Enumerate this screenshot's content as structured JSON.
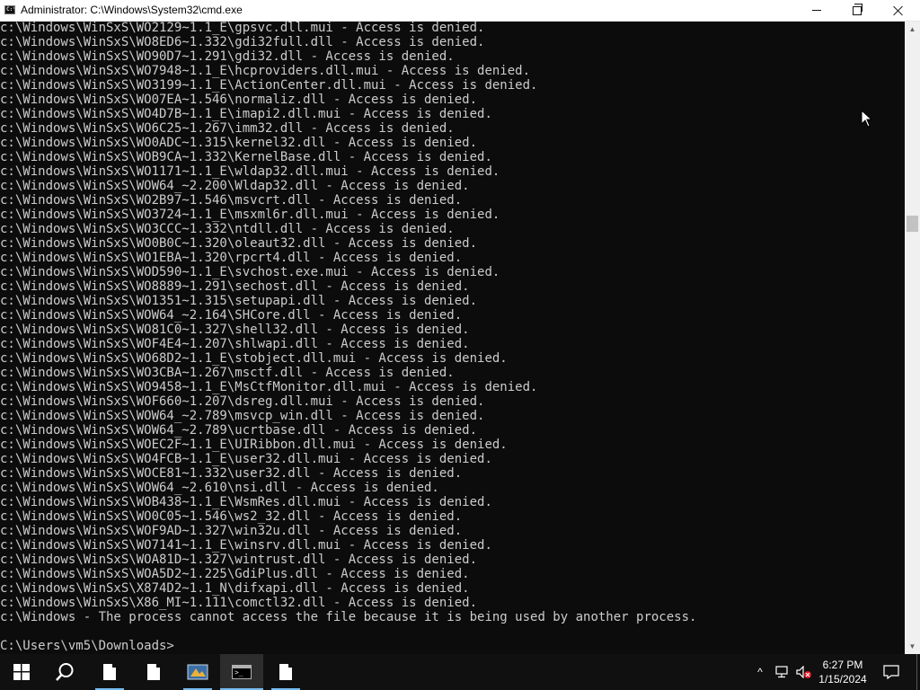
{
  "window": {
    "title": "Administrator: C:\\Windows\\System32\\cmd.exe",
    "app_icon_text": "C:\\"
  },
  "console": {
    "lines": [
      "c:\\Windows\\WinSxS\\WO2129~1.1_E\\gpsvc.dll.mui - Access is denied.",
      "c:\\Windows\\WinSxS\\WO8ED6~1.332\\gdi32full.dll - Access is denied.",
      "c:\\Windows\\WinSxS\\WO90D7~1.291\\gdi32.dll - Access is denied.",
      "c:\\Windows\\WinSxS\\WO7948~1.1_E\\hcproviders.dll.mui - Access is denied.",
      "c:\\Windows\\WinSxS\\WO3199~1.1_E\\ActionCenter.dll.mui - Access is denied.",
      "c:\\Windows\\WinSxS\\WO07EA~1.546\\normaliz.dll - Access is denied.",
      "c:\\Windows\\WinSxS\\WO4D7B~1.1_E\\imapi2.dll.mui - Access is denied.",
      "c:\\Windows\\WinSxS\\WO6C25~1.267\\imm32.dll - Access is denied.",
      "c:\\Windows\\WinSxS\\WO0ADC~1.315\\kernel32.dll - Access is denied.",
      "c:\\Windows\\WinSxS\\WOB9CA~1.332\\KernelBase.dll - Access is denied.",
      "c:\\Windows\\WinSxS\\WO1171~1.1_E\\wldap32.dll.mui - Access is denied.",
      "c:\\Windows\\WinSxS\\WOW64_~2.200\\Wldap32.dll - Access is denied.",
      "c:\\Windows\\WinSxS\\WO2B97~1.546\\msvcrt.dll - Access is denied.",
      "c:\\Windows\\WinSxS\\WO3724~1.1_E\\msxml6r.dll.mui - Access is denied.",
      "c:\\Windows\\WinSxS\\WO3CCC~1.332\\ntdll.dll - Access is denied.",
      "c:\\Windows\\WinSxS\\WO0B0C~1.320\\oleaut32.dll - Access is denied.",
      "c:\\Windows\\WinSxS\\WO1EBA~1.320\\rpcrt4.dll - Access is denied.",
      "c:\\Windows\\WinSxS\\WOD590~1.1_E\\svchost.exe.mui - Access is denied.",
      "c:\\Windows\\WinSxS\\WO8889~1.291\\sechost.dll - Access is denied.",
      "c:\\Windows\\WinSxS\\WO1351~1.315\\setupapi.dll - Access is denied.",
      "c:\\Windows\\WinSxS\\WOW64_~2.164\\SHCore.dll - Access is denied.",
      "c:\\Windows\\WinSxS\\WO81C0~1.327\\shell32.dll - Access is denied.",
      "c:\\Windows\\WinSxS\\WOF4E4~1.207\\shlwapi.dll - Access is denied.",
      "c:\\Windows\\WinSxS\\WO68D2~1.1_E\\stobject.dll.mui - Access is denied.",
      "c:\\Windows\\WinSxS\\WO3CBA~1.267\\msctf.dll - Access is denied.",
      "c:\\Windows\\WinSxS\\WO9458~1.1_E\\MsCtfMonitor.dll.mui - Access is denied.",
      "c:\\Windows\\WinSxS\\WOF660~1.207\\dsreg.dll.mui - Access is denied.",
      "c:\\Windows\\WinSxS\\WOW64_~2.789\\msvcp_win.dll - Access is denied.",
      "c:\\Windows\\WinSxS\\WOW64_~2.789\\ucrtbase.dll - Access is denied.",
      "c:\\Windows\\WinSxS\\WOEC2F~1.1_E\\UIRibbon.dll.mui - Access is denied.",
      "c:\\Windows\\WinSxS\\WO4FCB~1.1_E\\user32.dll.mui - Access is denied.",
      "c:\\Windows\\WinSxS\\WOCE81~1.332\\user32.dll - Access is denied.",
      "c:\\Windows\\WinSxS\\WOW64_~2.610\\nsi.dll - Access is denied.",
      "c:\\Windows\\WinSxS\\WOB438~1.1_E\\WsmRes.dll.mui - Access is denied.",
      "c:\\Windows\\WinSxS\\WO0C05~1.546\\ws2_32.dll - Access is denied.",
      "c:\\Windows\\WinSxS\\WOF9AD~1.327\\win32u.dll - Access is denied.",
      "c:\\Windows\\WinSxS\\WO7141~1.1_E\\winsrv.dll.mui - Access is denied.",
      "c:\\Windows\\WinSxS\\WOA81D~1.327\\wintrust.dll - Access is denied.",
      "c:\\Windows\\WinSxS\\WOA5D2~1.225\\GdiPlus.dll - Access is denied.",
      "c:\\Windows\\WinSxS\\X874D2~1.1_N\\difxapi.dll - Access is denied.",
      "c:\\Windows\\WinSxS\\X86_MI~1.111\\comctl32.dll - Access is denied.",
      "c:\\Windows - The process cannot access the file because it is being used by another process.",
      "",
      "C:\\Users\\vm5\\Downloads>"
    ]
  },
  "taskbar": {
    "items": [
      {
        "name": "start-button",
        "icon": "windows-logo-icon"
      },
      {
        "name": "search-button",
        "icon": "search-icon"
      },
      {
        "name": "taskbar-file-1",
        "icon": "document-icon"
      },
      {
        "name": "taskbar-file-2",
        "icon": "document-icon"
      },
      {
        "name": "taskbar-app",
        "icon": "app-icon"
      },
      {
        "name": "taskbar-cmd",
        "icon": "cmd-icon"
      },
      {
        "name": "taskbar-file-3",
        "icon": "document-icon"
      }
    ],
    "tray": {
      "chevron": "^",
      "time": "6:27 PM",
      "date": "1/15/2024"
    }
  },
  "colors": {
    "console_bg": "#0c0c0c",
    "console_fg": "#cccccc",
    "taskbar_bg": "#101010",
    "accent": "#76b9ed"
  }
}
